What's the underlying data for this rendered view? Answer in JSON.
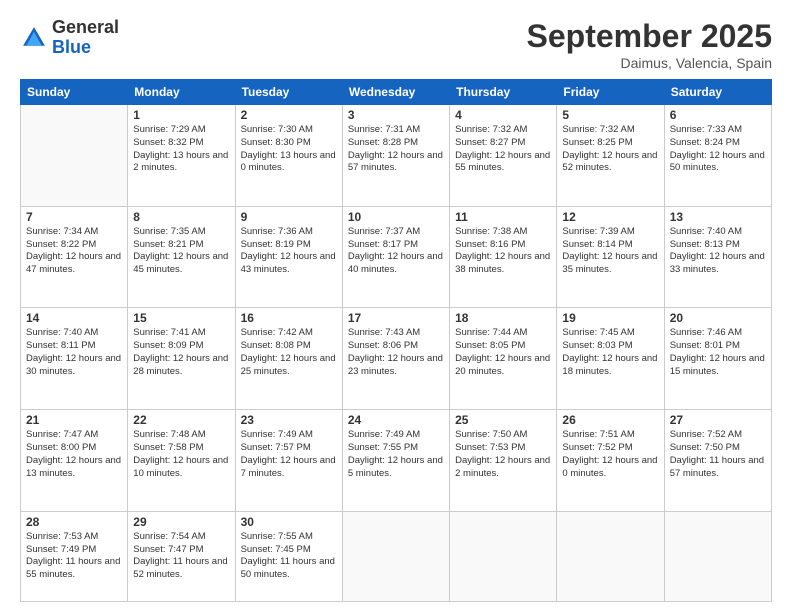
{
  "logo": {
    "general": "General",
    "blue": "Blue"
  },
  "title": {
    "month": "September 2025",
    "location": "Daimus, Valencia, Spain"
  },
  "weekdays": [
    "Sunday",
    "Monday",
    "Tuesday",
    "Wednesday",
    "Thursday",
    "Friday",
    "Saturday"
  ],
  "weeks": [
    [
      {
        "day": "",
        "sunrise": "",
        "sunset": "",
        "daylight": ""
      },
      {
        "day": "1",
        "sunrise": "Sunrise: 7:29 AM",
        "sunset": "Sunset: 8:32 PM",
        "daylight": "Daylight: 13 hours and 2 minutes."
      },
      {
        "day": "2",
        "sunrise": "Sunrise: 7:30 AM",
        "sunset": "Sunset: 8:30 PM",
        "daylight": "Daylight: 13 hours and 0 minutes."
      },
      {
        "day": "3",
        "sunrise": "Sunrise: 7:31 AM",
        "sunset": "Sunset: 8:28 PM",
        "daylight": "Daylight: 12 hours and 57 minutes."
      },
      {
        "day": "4",
        "sunrise": "Sunrise: 7:32 AM",
        "sunset": "Sunset: 8:27 PM",
        "daylight": "Daylight: 12 hours and 55 minutes."
      },
      {
        "day": "5",
        "sunrise": "Sunrise: 7:32 AM",
        "sunset": "Sunset: 8:25 PM",
        "daylight": "Daylight: 12 hours and 52 minutes."
      },
      {
        "day": "6",
        "sunrise": "Sunrise: 7:33 AM",
        "sunset": "Sunset: 8:24 PM",
        "daylight": "Daylight: 12 hours and 50 minutes."
      }
    ],
    [
      {
        "day": "7",
        "sunrise": "Sunrise: 7:34 AM",
        "sunset": "Sunset: 8:22 PM",
        "daylight": "Daylight: 12 hours and 47 minutes."
      },
      {
        "day": "8",
        "sunrise": "Sunrise: 7:35 AM",
        "sunset": "Sunset: 8:21 PM",
        "daylight": "Daylight: 12 hours and 45 minutes."
      },
      {
        "day": "9",
        "sunrise": "Sunrise: 7:36 AM",
        "sunset": "Sunset: 8:19 PM",
        "daylight": "Daylight: 12 hours and 43 minutes."
      },
      {
        "day": "10",
        "sunrise": "Sunrise: 7:37 AM",
        "sunset": "Sunset: 8:17 PM",
        "daylight": "Daylight: 12 hours and 40 minutes."
      },
      {
        "day": "11",
        "sunrise": "Sunrise: 7:38 AM",
        "sunset": "Sunset: 8:16 PM",
        "daylight": "Daylight: 12 hours and 38 minutes."
      },
      {
        "day": "12",
        "sunrise": "Sunrise: 7:39 AM",
        "sunset": "Sunset: 8:14 PM",
        "daylight": "Daylight: 12 hours and 35 minutes."
      },
      {
        "day": "13",
        "sunrise": "Sunrise: 7:40 AM",
        "sunset": "Sunset: 8:13 PM",
        "daylight": "Daylight: 12 hours and 33 minutes."
      }
    ],
    [
      {
        "day": "14",
        "sunrise": "Sunrise: 7:40 AM",
        "sunset": "Sunset: 8:11 PM",
        "daylight": "Daylight: 12 hours and 30 minutes."
      },
      {
        "day": "15",
        "sunrise": "Sunrise: 7:41 AM",
        "sunset": "Sunset: 8:09 PM",
        "daylight": "Daylight: 12 hours and 28 minutes."
      },
      {
        "day": "16",
        "sunrise": "Sunrise: 7:42 AM",
        "sunset": "Sunset: 8:08 PM",
        "daylight": "Daylight: 12 hours and 25 minutes."
      },
      {
        "day": "17",
        "sunrise": "Sunrise: 7:43 AM",
        "sunset": "Sunset: 8:06 PM",
        "daylight": "Daylight: 12 hours and 23 minutes."
      },
      {
        "day": "18",
        "sunrise": "Sunrise: 7:44 AM",
        "sunset": "Sunset: 8:05 PM",
        "daylight": "Daylight: 12 hours and 20 minutes."
      },
      {
        "day": "19",
        "sunrise": "Sunrise: 7:45 AM",
        "sunset": "Sunset: 8:03 PM",
        "daylight": "Daylight: 12 hours and 18 minutes."
      },
      {
        "day": "20",
        "sunrise": "Sunrise: 7:46 AM",
        "sunset": "Sunset: 8:01 PM",
        "daylight": "Daylight: 12 hours and 15 minutes."
      }
    ],
    [
      {
        "day": "21",
        "sunrise": "Sunrise: 7:47 AM",
        "sunset": "Sunset: 8:00 PM",
        "daylight": "Daylight: 12 hours and 13 minutes."
      },
      {
        "day": "22",
        "sunrise": "Sunrise: 7:48 AM",
        "sunset": "Sunset: 7:58 PM",
        "daylight": "Daylight: 12 hours and 10 minutes."
      },
      {
        "day": "23",
        "sunrise": "Sunrise: 7:49 AM",
        "sunset": "Sunset: 7:57 PM",
        "daylight": "Daylight: 12 hours and 7 minutes."
      },
      {
        "day": "24",
        "sunrise": "Sunrise: 7:49 AM",
        "sunset": "Sunset: 7:55 PM",
        "daylight": "Daylight: 12 hours and 5 minutes."
      },
      {
        "day": "25",
        "sunrise": "Sunrise: 7:50 AM",
        "sunset": "Sunset: 7:53 PM",
        "daylight": "Daylight: 12 hours and 2 minutes."
      },
      {
        "day": "26",
        "sunrise": "Sunrise: 7:51 AM",
        "sunset": "Sunset: 7:52 PM",
        "daylight": "Daylight: 12 hours and 0 minutes."
      },
      {
        "day": "27",
        "sunrise": "Sunrise: 7:52 AM",
        "sunset": "Sunset: 7:50 PM",
        "daylight": "Daylight: 11 hours and 57 minutes."
      }
    ],
    [
      {
        "day": "28",
        "sunrise": "Sunrise: 7:53 AM",
        "sunset": "Sunset: 7:49 PM",
        "daylight": "Daylight: 11 hours and 55 minutes."
      },
      {
        "day": "29",
        "sunrise": "Sunrise: 7:54 AM",
        "sunset": "Sunset: 7:47 PM",
        "daylight": "Daylight: 11 hours and 52 minutes."
      },
      {
        "day": "30",
        "sunrise": "Sunrise: 7:55 AM",
        "sunset": "Sunset: 7:45 PM",
        "daylight": "Daylight: 11 hours and 50 minutes."
      },
      {
        "day": "",
        "sunrise": "",
        "sunset": "",
        "daylight": ""
      },
      {
        "day": "",
        "sunrise": "",
        "sunset": "",
        "daylight": ""
      },
      {
        "day": "",
        "sunrise": "",
        "sunset": "",
        "daylight": ""
      },
      {
        "day": "",
        "sunrise": "",
        "sunset": "",
        "daylight": ""
      }
    ]
  ]
}
